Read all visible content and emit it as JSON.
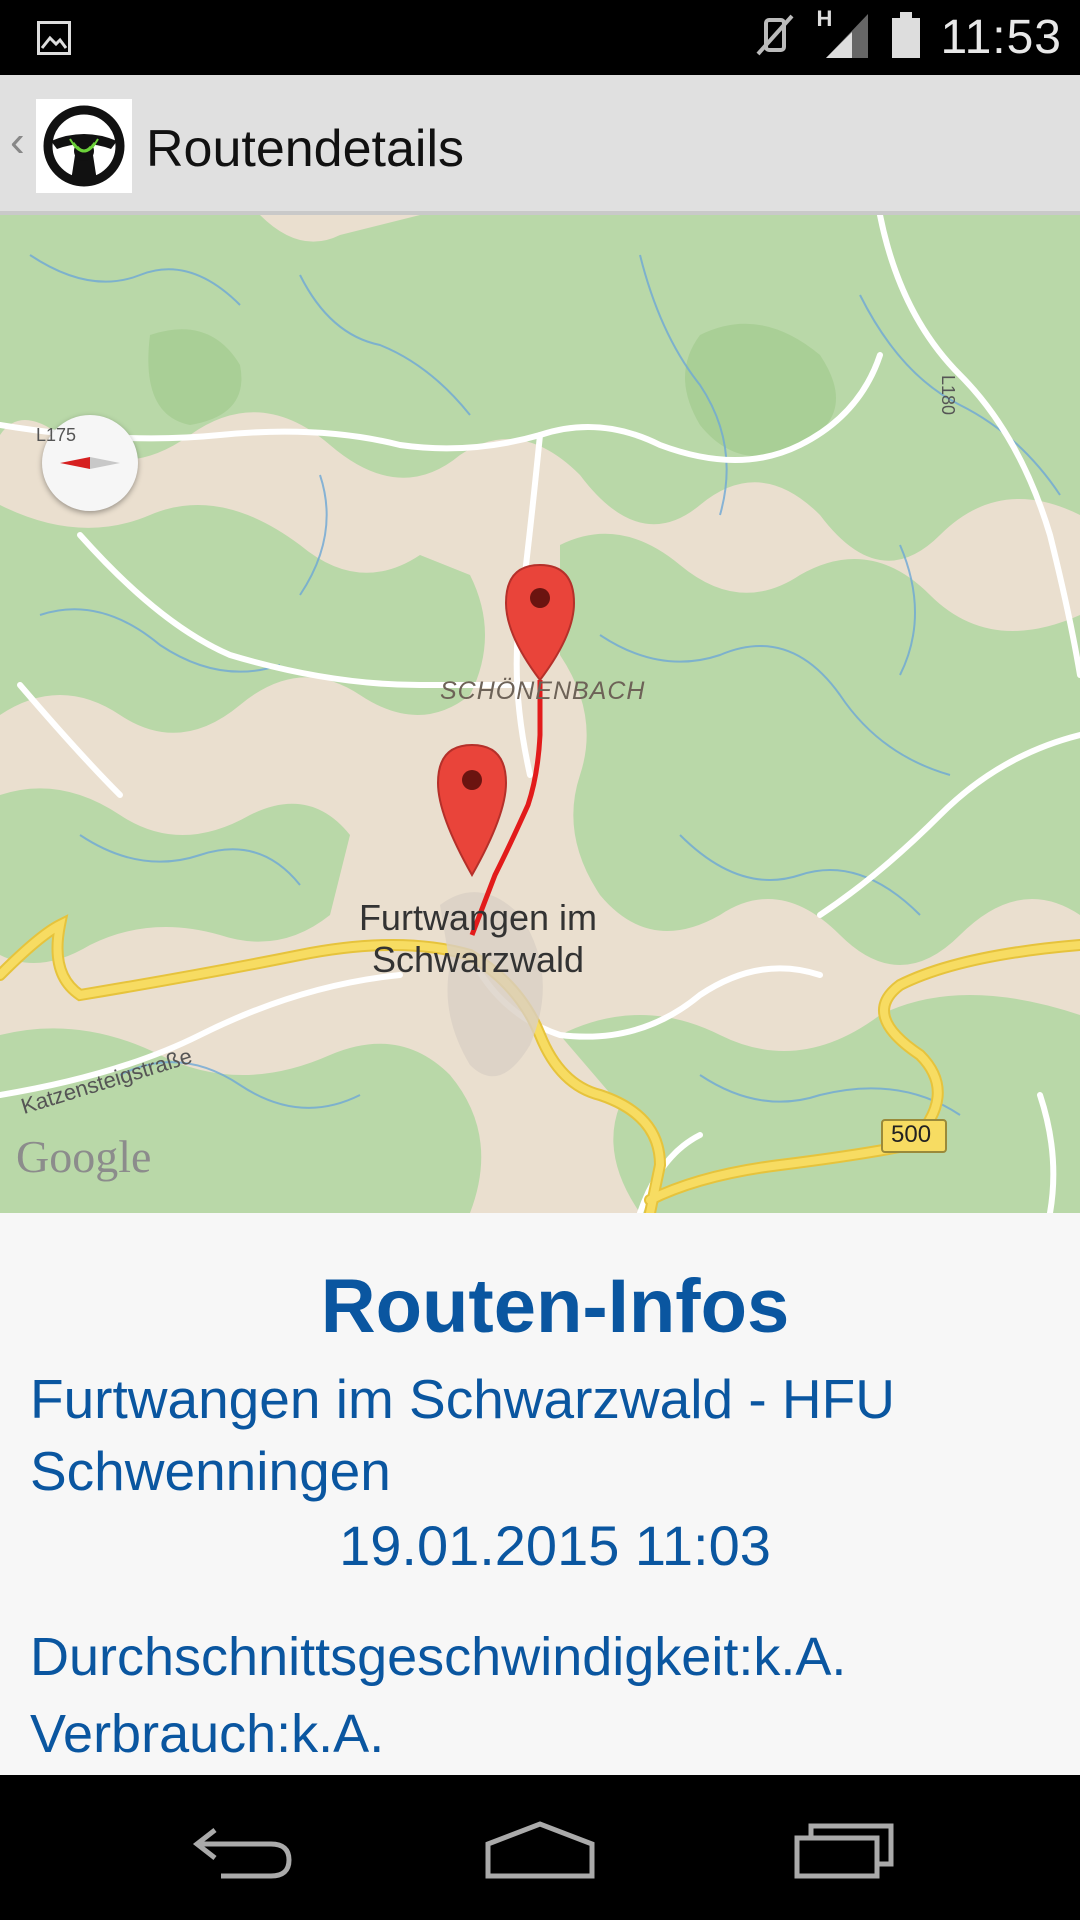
{
  "status_bar": {
    "time": "11:53",
    "network_label": "H",
    "icons": [
      "image-notification-icon",
      "vibrate-icon",
      "signal-icon",
      "battery-icon"
    ]
  },
  "action_bar": {
    "title": "Routendetails",
    "app_icon": "steering-wheel-icon"
  },
  "map": {
    "labels": {
      "road_l175": "L175",
      "road_l180": "L180",
      "village": "SCHÖNENBACH",
      "town_line1": "Furtwangen im",
      "town_line2": "Schwarzwald",
      "street": "Katzensteigstraße",
      "road_500": "500",
      "attribution": "Google"
    },
    "colors": {
      "route": "#e21b1b",
      "marker": "#e9443a",
      "forest": "#b9d8a8",
      "land": "#eadfcf",
      "road_major": "#f5d452",
      "water": "#6ea8d6"
    }
  },
  "route_info": {
    "heading": "Routen-Infos",
    "route_name": "Furtwangen im Schwarzwald - HFU Schwenningen",
    "datetime": "19.01.2015 11:03",
    "avg_speed": "Durchschnittsgeschwindigkeit:k.A.",
    "consumption": "Verbrauch:k.A."
  },
  "nav_bar": {
    "buttons": [
      "back-icon",
      "home-icon",
      "recent-apps-icon"
    ]
  }
}
